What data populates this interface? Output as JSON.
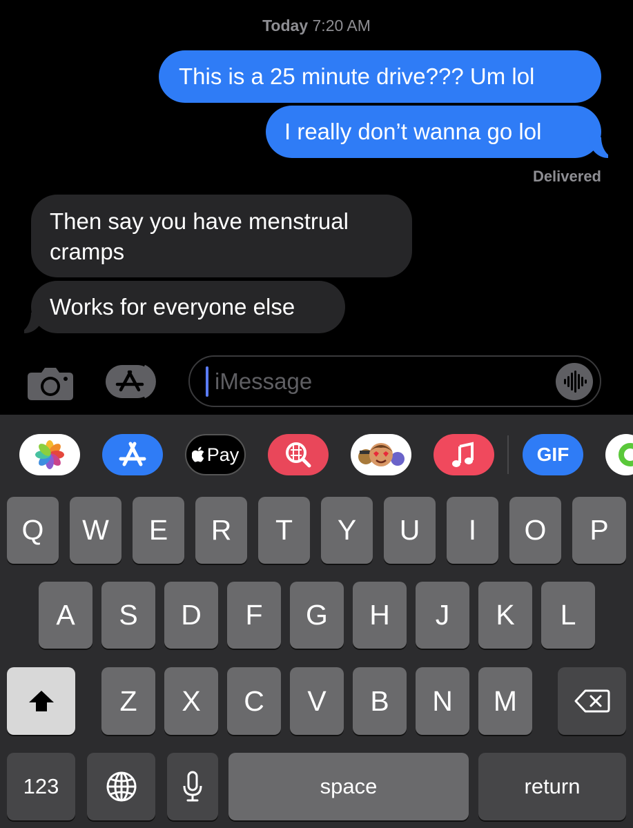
{
  "conversation": {
    "timestamp_day": "Today",
    "timestamp_time": "7:20 AM",
    "messages": [
      {
        "direction": "sent",
        "text": "This is a 25 minute drive??? Um lol"
      },
      {
        "direction": "sent",
        "text": "I really don’t wanna go lol"
      },
      {
        "direction": "received",
        "text": "Then say you have menstrual cramps"
      },
      {
        "direction": "received",
        "text": "Works for everyone else"
      }
    ],
    "status": "Delivered"
  },
  "input_bar": {
    "placeholder": "iMessage",
    "icons": [
      "camera-icon",
      "app-store-icon",
      "audio-waveform-icon"
    ]
  },
  "app_tray": {
    "items": [
      "Photos",
      "App Store",
      "Apple Pay",
      "Image Search",
      "Memoji",
      "Music",
      "GIF",
      "Activity"
    ],
    "applepay_label": "Pay",
    "gif_label": "GIF"
  },
  "keyboard": {
    "row1": [
      "Q",
      "W",
      "E",
      "R",
      "T",
      "Y",
      "U",
      "I",
      "O",
      "P"
    ],
    "row2": [
      "A",
      "S",
      "D",
      "F",
      "G",
      "H",
      "J",
      "K",
      "L"
    ],
    "row3": [
      "Z",
      "X",
      "C",
      "V",
      "B",
      "N",
      "M"
    ],
    "numbers_label": "123",
    "space_label": "space",
    "return_label": "return"
  },
  "colors": {
    "sent_bubble": "#2f7cf6",
    "received_bubble": "#262628",
    "keyboard_bg": "#2c2c2e",
    "key": "#6a6a6c"
  }
}
